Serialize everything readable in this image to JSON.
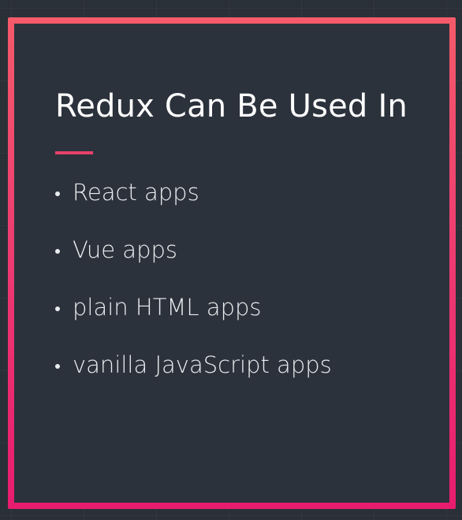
{
  "slide": {
    "title": "Redux Can Be Used In",
    "bullets": [
      {
        "label": "React apps"
      },
      {
        "label": "Vue apps"
      },
      {
        "label": "plain HTML apps"
      },
      {
        "label": "vanilla JavaScript apps"
      }
    ]
  },
  "colors": {
    "background": "#2a3038",
    "panel": "#2c323c",
    "frame_gradient_top": "#f45a6a",
    "frame_gradient_bottom": "#e81c6f",
    "accent_underline": "#e6416a",
    "text": "#ffffff"
  }
}
